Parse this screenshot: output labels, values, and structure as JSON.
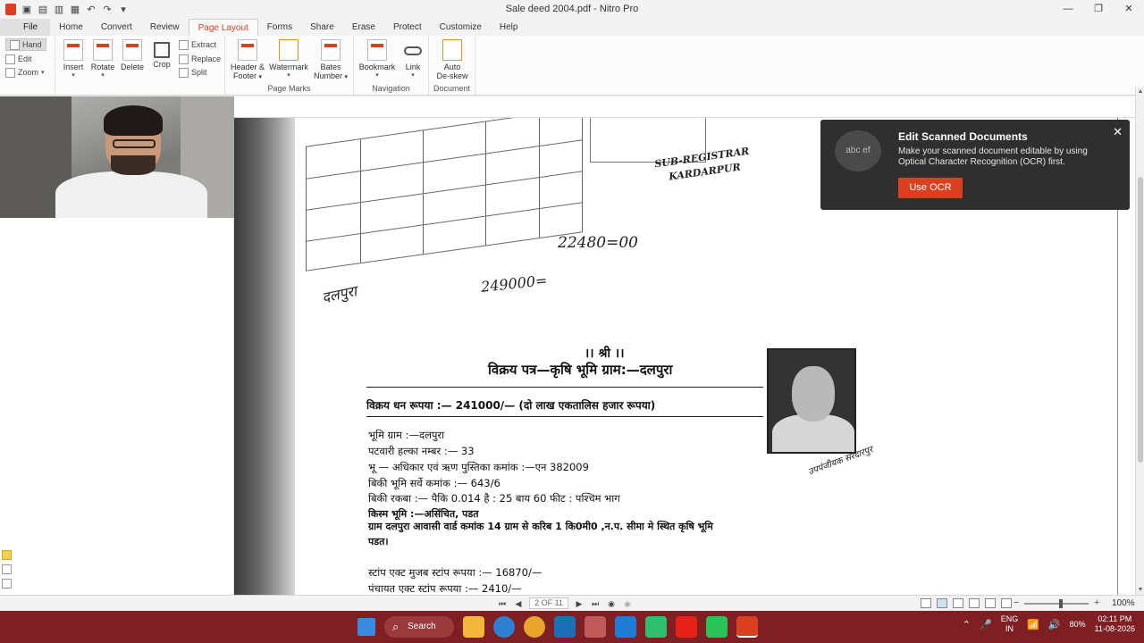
{
  "window": {
    "title": "Sale deed 2004.pdf - Nitro Pro",
    "minimize": "—",
    "restore": "❐",
    "close": "✕"
  },
  "qat": {
    "open": "▣",
    "save": "▤",
    "print": "▥",
    "email": "▦",
    "undo": "↶",
    "redo": "↷",
    "more": "▾"
  },
  "tabs": [
    "File",
    "Home",
    "Convert",
    "Review",
    "Page Layout",
    "Forms",
    "Share",
    "Erase",
    "Protect",
    "Customize",
    "Help"
  ],
  "ribbon": {
    "tools": {
      "hand": "Hand",
      "edit": "Edit",
      "zoom": "Zoom"
    },
    "pages": {
      "insert": "Insert",
      "rotate": "Rotate",
      "delete": "Delete",
      "crop": "Crop",
      "extract": "Extract",
      "replace": "Replace",
      "split": "Split"
    },
    "page_marks": {
      "header_footer_1": "Header &",
      "header_footer_2": "Footer",
      "watermark": "Watermark",
      "bates_1": "Bates",
      "bates_2": "Number",
      "label": "Page Marks"
    },
    "navigation": {
      "bookmark": "Bookmark",
      "link": "Link",
      "label": "Navigation"
    },
    "document": {
      "deskew_1": "Auto",
      "deskew_2": "De-skew",
      "label": "Document"
    }
  },
  "document": {
    "stamp_1": "SUB-REGISTRAR",
    "stamp_2": "KARDARPUR",
    "handwritten_amount_1": "22480=00",
    "handwritten_amount_2": "249000=",
    "handwritten_village": "दलपुरा",
    "shri": "।। श्री ।।",
    "title": "विक्रय पत्र—कृषि भूमि ग्राम:—दलपुरा",
    "amount_line": "विक्रय धन रूपया :— 241000/— (दो लाख एकतालिस हजार रूपया)",
    "lines": [
      "भूमि ग्राम :—दलपुरा",
      "पटवारी हल्का नम्बर :— 33",
      "भू — अधिकार एवं ऋण पुस्तिका कमांक :—एन 382009",
      "बिकी भूमि सर्वे कमांक :— 643/6",
      "बिकी रकबा :— पैकि 0.014 है : 25 बाय 60 फीट : पश्चिम भाग",
      "किस्म भूमि :—असिंचित, पडत",
      "ग्राम दलपुरा आवासी वार्ड कमांक 14 ग्राम से करिब 1 कि0मी0 ,न.प. सीमा मे स्थित कृषि भूमि",
      "पडत।"
    ],
    "stamp_lines": [
      "स्टांप एक्ट मुजब स्टांप रूपया :— 16870/—",
      "पंचायत एक्ट स्टांप रूपया :— 2410/—"
    ],
    "photo_caption": "उपपंजीयक सरदारपुर"
  },
  "ocr_popup": {
    "badge": "abc ef",
    "title": "Edit Scanned Documents",
    "description": "Make your scanned document editable by using Optical Character Recognition (OCR) first.",
    "button": "Use OCR",
    "close": "✕"
  },
  "statusbar": {
    "first": "⏮",
    "prev": "◀",
    "page": "2 OF 11",
    "next": "▶",
    "last": "⏭",
    "back": "◉",
    "forward": "◉",
    "zoom_minus": "−",
    "zoom_plus": "+",
    "zoom": "100%",
    "zoom_level": 0.58
  },
  "taskbar": {
    "search": "Search",
    "lang_1": "ENG",
    "lang_2": "IN",
    "battery": "80%",
    "time": "02:11 PM",
    "date": "11-08-2026",
    "tray_up": "⌃",
    "mic": "🎤",
    "wifi": "📶",
    "volume": "🔊"
  },
  "colors": {
    "accent": "#d9401f",
    "taskbar": "#7d1f23",
    "popup_bg": "#2f2f2f"
  }
}
